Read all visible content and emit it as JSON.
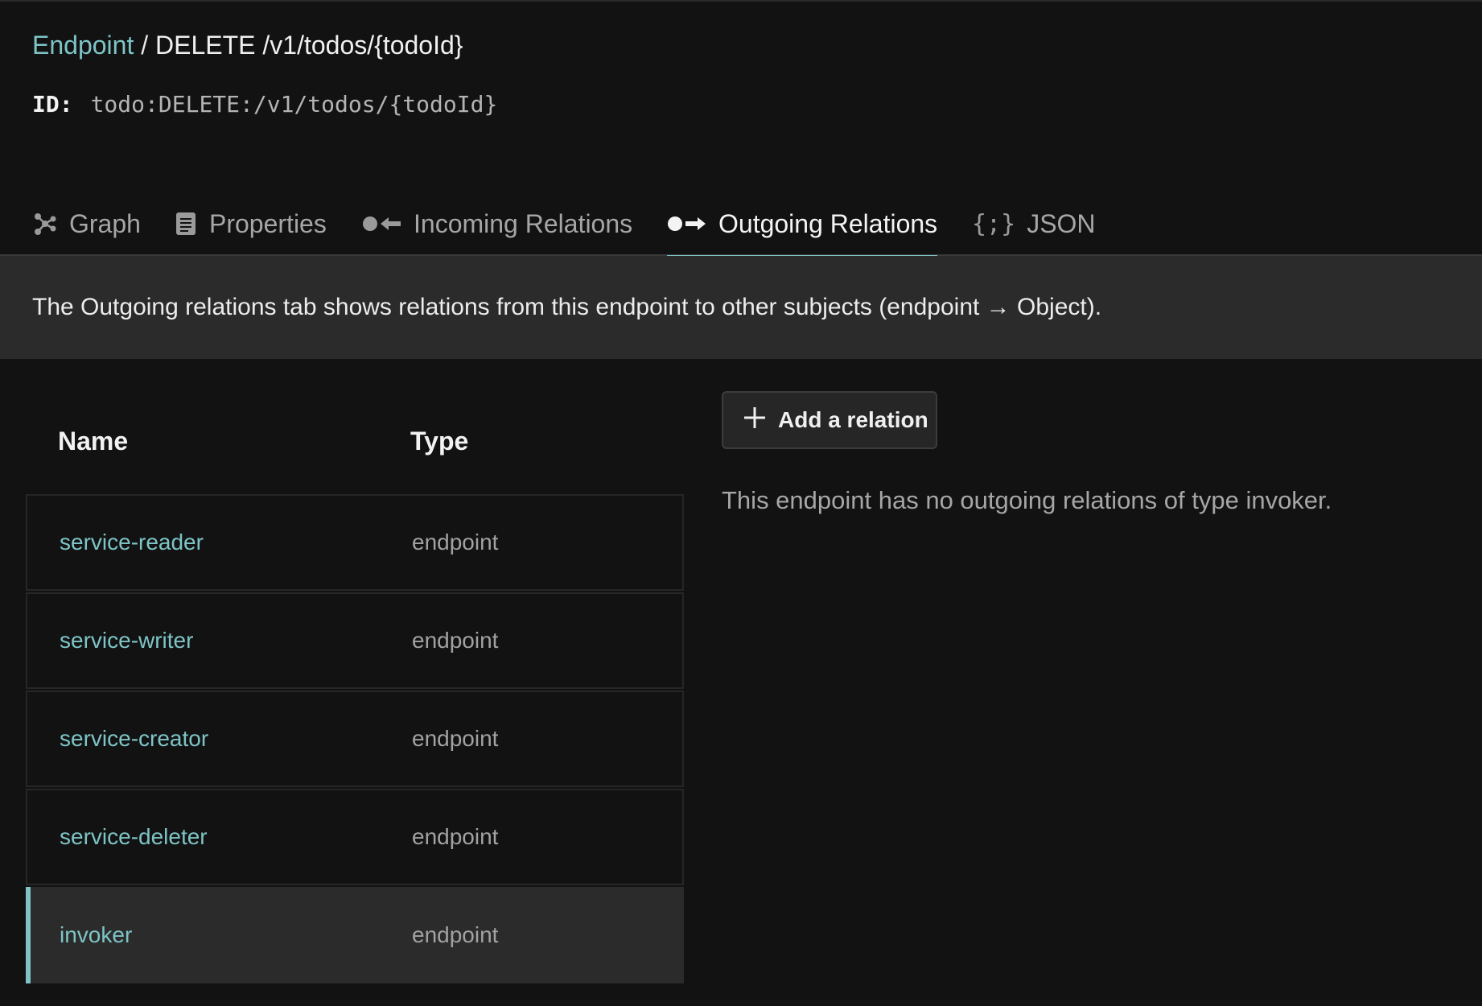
{
  "breadcrumb": {
    "link": "Endpoint",
    "separator": " / ",
    "current": "DELETE /v1/todos/{todoId}"
  },
  "id_line": {
    "label": "ID:",
    "value": "todo:DELETE:/v1/todos/{todoId}"
  },
  "tabs": [
    {
      "label": "Graph",
      "icon": "graph-icon",
      "active": false
    },
    {
      "label": "Properties",
      "icon": "document-icon",
      "active": false
    },
    {
      "label": "Incoming Relations",
      "icon": "incoming-arrow-icon",
      "active": false
    },
    {
      "label": "Outgoing Relations",
      "icon": "outgoing-arrow-icon",
      "active": true
    },
    {
      "label": "JSON",
      "icon": "braces-icon",
      "active": false
    }
  ],
  "info_banner": "The Outgoing relations tab shows relations from this endpoint to other subjects (endpoint → Object).",
  "table": {
    "headers": {
      "name": "Name",
      "type": "Type"
    },
    "rows": [
      {
        "name": "service-reader",
        "type": "endpoint",
        "selected": false
      },
      {
        "name": "service-writer",
        "type": "endpoint",
        "selected": false
      },
      {
        "name": "service-creator",
        "type": "endpoint",
        "selected": false
      },
      {
        "name": "service-deleter",
        "type": "endpoint",
        "selected": false
      },
      {
        "name": "invoker",
        "type": "endpoint",
        "selected": true
      }
    ]
  },
  "add_button": {
    "label": "Add a relation",
    "icon": "plus-icon"
  },
  "empty_message": "This endpoint has no outgoing relations of type invoker.",
  "colors": {
    "accent": "#7ec4c6",
    "background": "#121212",
    "panel": "#2b2b2b"
  }
}
